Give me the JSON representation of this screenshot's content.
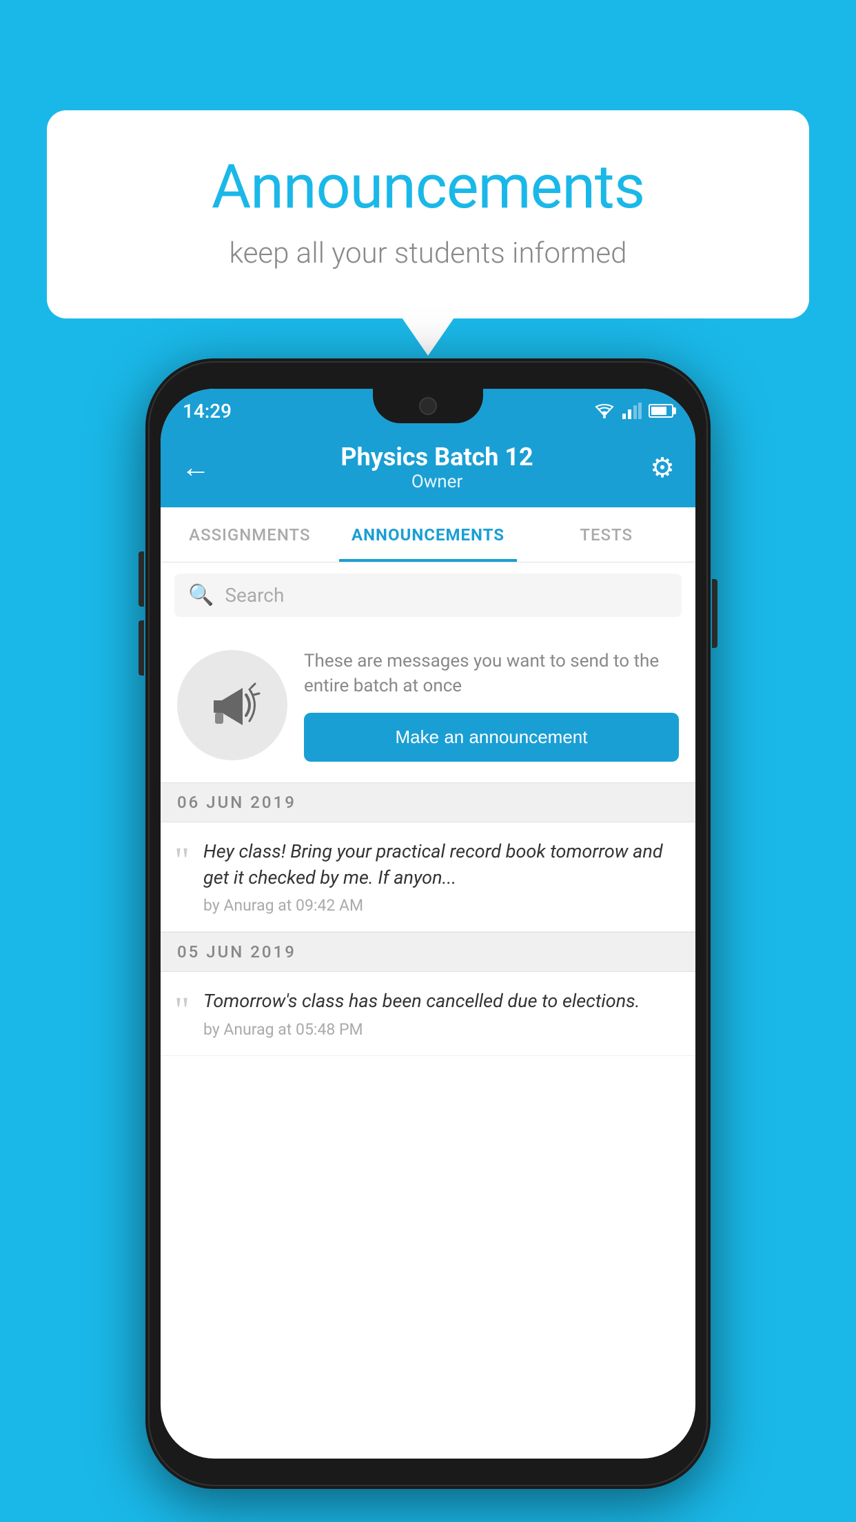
{
  "background": {
    "color": "#1ab8e8"
  },
  "speech_bubble": {
    "title": "Announcements",
    "subtitle": "keep all your students informed"
  },
  "phone": {
    "status_bar": {
      "time": "14:29"
    },
    "app_bar": {
      "title": "Physics Batch 12",
      "subtitle": "Owner",
      "back_label": "←",
      "settings_label": "⚙"
    },
    "tabs": [
      {
        "label": "ASSIGNMENTS",
        "active": false
      },
      {
        "label": "ANNOUNCEMENTS",
        "active": true
      },
      {
        "label": "TESTS",
        "active": false
      }
    ],
    "search": {
      "placeholder": "Search"
    },
    "promo": {
      "text": "These are messages you want to send to the entire batch at once",
      "button_label": "Make an announcement"
    },
    "date_groups": [
      {
        "date": "06  JUN  2019",
        "announcements": [
          {
            "text": "Hey class! Bring your practical record book tomorrow and get it checked by me. If anyon...",
            "meta": "by Anurag at 09:42 AM"
          }
        ]
      },
      {
        "date": "05  JUN  2019",
        "announcements": [
          {
            "text": "Tomorrow's class has been cancelled due to elections.",
            "meta": "by Anurag at 05:48 PM"
          }
        ]
      }
    ]
  }
}
